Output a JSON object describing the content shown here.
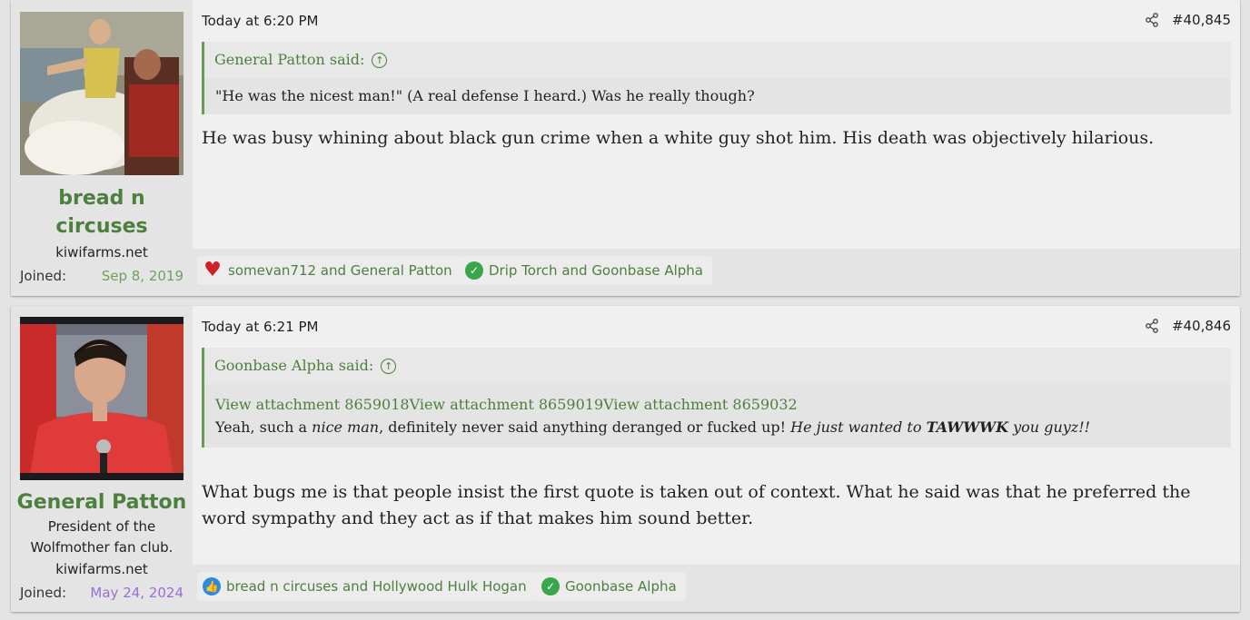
{
  "posts": [
    {
      "username": "bread n circuses",
      "username_line1": "bread n",
      "username_line2": "circuses",
      "site": "kiwifarms.net",
      "joined_label": "Joined:",
      "joined_date": "Sep 8, 2019",
      "joined_color": "#6fa25c",
      "timestamp": "Today at 6:20 PM",
      "post_number": "#40,845",
      "quote": {
        "author_line": "General Patton said:",
        "text": "\"He was the nicest man!\" (A real defense I heard.) Was he really though?"
      },
      "body": "He was busy whining about black gun crime when a white guy shot him. His death was objectively hilarious.",
      "reactions": [
        {
          "icon": "heart-icon",
          "text": "somevan712 and General Patton"
        },
        {
          "icon": "check-icon",
          "text": "Drip Torch and Goonbase Alpha"
        }
      ]
    },
    {
      "username": "General Patton",
      "title_line1": "President of the",
      "title_line2": "Wolfmother fan club.",
      "site": "kiwifarms.net",
      "joined_label": "Joined:",
      "joined_date": "May 24, 2024",
      "joined_color": "#9a6fd8",
      "timestamp": "Today at 6:21 PM",
      "post_number": "#40,846",
      "quote": {
        "author_line": "Goonbase Alpha said:",
        "attachments": [
          "View attachment 8659018",
          "View attachment 8659019",
          "View attachment 8659032"
        ],
        "text_a": "Yeah, such a ",
        "text_b": "nice man",
        "text_c": ", definitely never said anything deranged or fucked up! ",
        "text_d": "He just wanted to ",
        "text_e": "TAWWWK",
        "text_f": " you guyz!!"
      },
      "body": "What bugs me is that people insist the first quote is taken out of context. What he said was that he preferred the word sympathy and they act as if that makes him sound better.",
      "reactions": [
        {
          "icon": "like-icon",
          "text": "bread n circuses and Hollywood Hulk Hogan"
        },
        {
          "icon": "check-icon",
          "text": "Goonbase Alpha"
        }
      ]
    }
  ]
}
